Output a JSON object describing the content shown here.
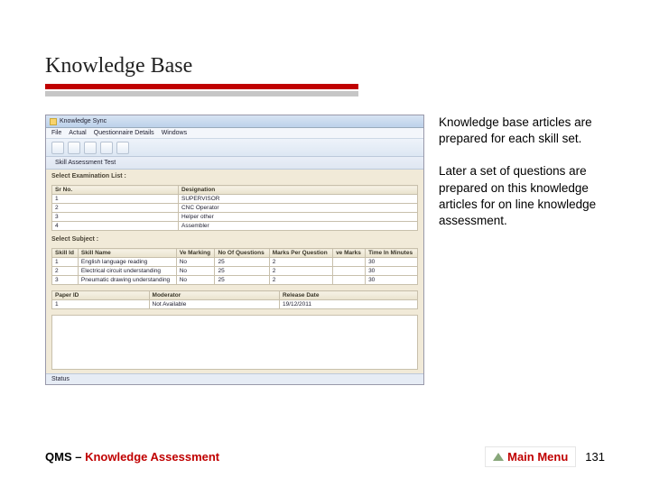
{
  "title": "Knowledge Base",
  "side": {
    "p1": "Knowledge base articles are prepared for each skill set.",
    "p2": "Later a set of questions are prepared on this knowledge articles for on line knowledge assessment."
  },
  "shot": {
    "window_title": "Knowledge Sync",
    "menu": [
      "File",
      "Actual",
      "Questionnaire Details",
      "Windows"
    ],
    "sub_title": "Skill Assessment Test",
    "section1_label": "Select Examination List :",
    "table1": {
      "headers": [
        "Sr No.",
        "Designation"
      ],
      "rows": [
        [
          "1",
          "SUPERVISOR"
        ],
        [
          "2",
          "CNC Operator"
        ],
        [
          "3",
          "Helper other"
        ],
        [
          "4",
          "Assembler"
        ]
      ]
    },
    "section2_label": "Select Subject :",
    "table2": {
      "headers": [
        "Skill Id",
        "Skill Name",
        "Ve Marking",
        "No Of Questions",
        "Marks Per Question",
        "ve Marks",
        "Time In Minutes"
      ],
      "rows": [
        [
          "1",
          "English language reading",
          "No",
          "25",
          "2",
          "",
          "30"
        ],
        [
          "2",
          "Electrical circuit understanding",
          "No",
          "25",
          "2",
          "",
          "30"
        ],
        [
          "3",
          "Pneumatic drawing understanding",
          "No",
          "25",
          "2",
          "",
          "30"
        ]
      ]
    },
    "table3": {
      "headers": [
        "Paper ID",
        "Moderator",
        "Release Date"
      ],
      "rows": [
        [
          "1",
          "Not Available",
          "19/12/2011"
        ]
      ]
    },
    "status": "Status"
  },
  "footer": {
    "left_prefix": "QMS – ",
    "left_main": "Knowledge Assessment",
    "main_menu": "Main Menu",
    "page": "131"
  }
}
